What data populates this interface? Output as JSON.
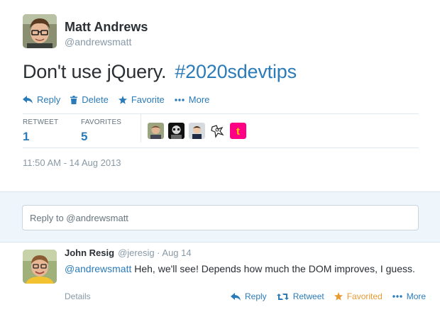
{
  "tweet": {
    "author_name": "Matt Andrews",
    "author_handle": "@andrewsmatt",
    "text_plain": "Don't use jQuery.",
    "hashtag": "#2020sdevtips",
    "actions": {
      "reply": "Reply",
      "delete": "Delete",
      "favorite": "Favorite",
      "more": "More"
    },
    "stats": {
      "retweet_label": "RETWEET",
      "retweet_count": "1",
      "favorites_label": "FAVORITES",
      "favorites_count": "5"
    },
    "timestamp": "11:50 AM - 14 Aug 2013"
  },
  "reply_input": {
    "placeholder": "Reply to @andrewsmatt"
  },
  "reply": {
    "author_name": "John Resig",
    "meta": "@jeresig · Aug 14",
    "mention": "@andrewsmatt",
    "text": " Heh, we'll see! Depends how much the DOM improves, I guess.",
    "details": "Details",
    "actions": {
      "reply": "Reply",
      "retweet": "Retweet",
      "favorited": "Favorited",
      "more": "More"
    }
  },
  "colors": {
    "link": "#2b7bb9",
    "favorited": "#e89a33",
    "muted": "#8899a6",
    "reply_area_bg": "#eff6fb"
  },
  "icons": [
    "reply-icon",
    "trash-icon",
    "star-icon",
    "more-dots-icon",
    "retweet-icon"
  ]
}
